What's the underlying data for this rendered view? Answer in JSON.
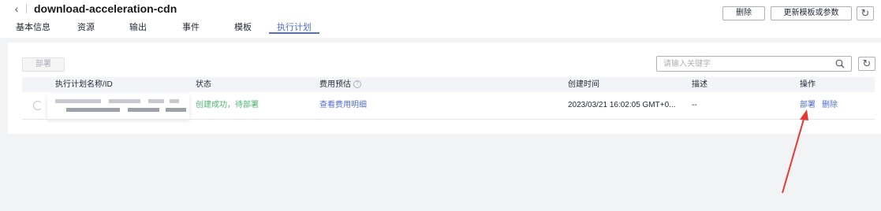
{
  "header": {
    "back_icon": "chevron-left-icon",
    "title": "download-acceleration-cdn",
    "delete_label": "删除",
    "update_label": "更新模板或参数",
    "refresh_icon": "refresh-icon"
  },
  "tabs": [
    {
      "label": "基本信息",
      "active": false
    },
    {
      "label": "资源",
      "active": false
    },
    {
      "label": "输出",
      "active": false
    },
    {
      "label": "事件",
      "active": false
    },
    {
      "label": "模板",
      "active": false
    },
    {
      "label": "执行计划",
      "active": true
    }
  ],
  "toolbar": {
    "deploy_label": "部署",
    "search_placeholder": "请输入关键字",
    "search_icon": "search-icon",
    "refresh_icon": "refresh-icon"
  },
  "table": {
    "columns": [
      "执行计划名称/ID",
      "状态",
      "费用预估",
      "创建时间",
      "描述",
      "操作"
    ],
    "help_icon_text": "?",
    "rows": [
      {
        "name": "",
        "status": "创建成功，待部署",
        "cost": "查看费用明细",
        "created": "2023/03/21 16:02:05 GMT+0...",
        "description": "--",
        "action_deploy": "部署",
        "action_delete": "删除"
      }
    ]
  },
  "colors": {
    "accent": "#526ecc",
    "success": "#50b371",
    "annotation_arrow": "#e53935"
  }
}
